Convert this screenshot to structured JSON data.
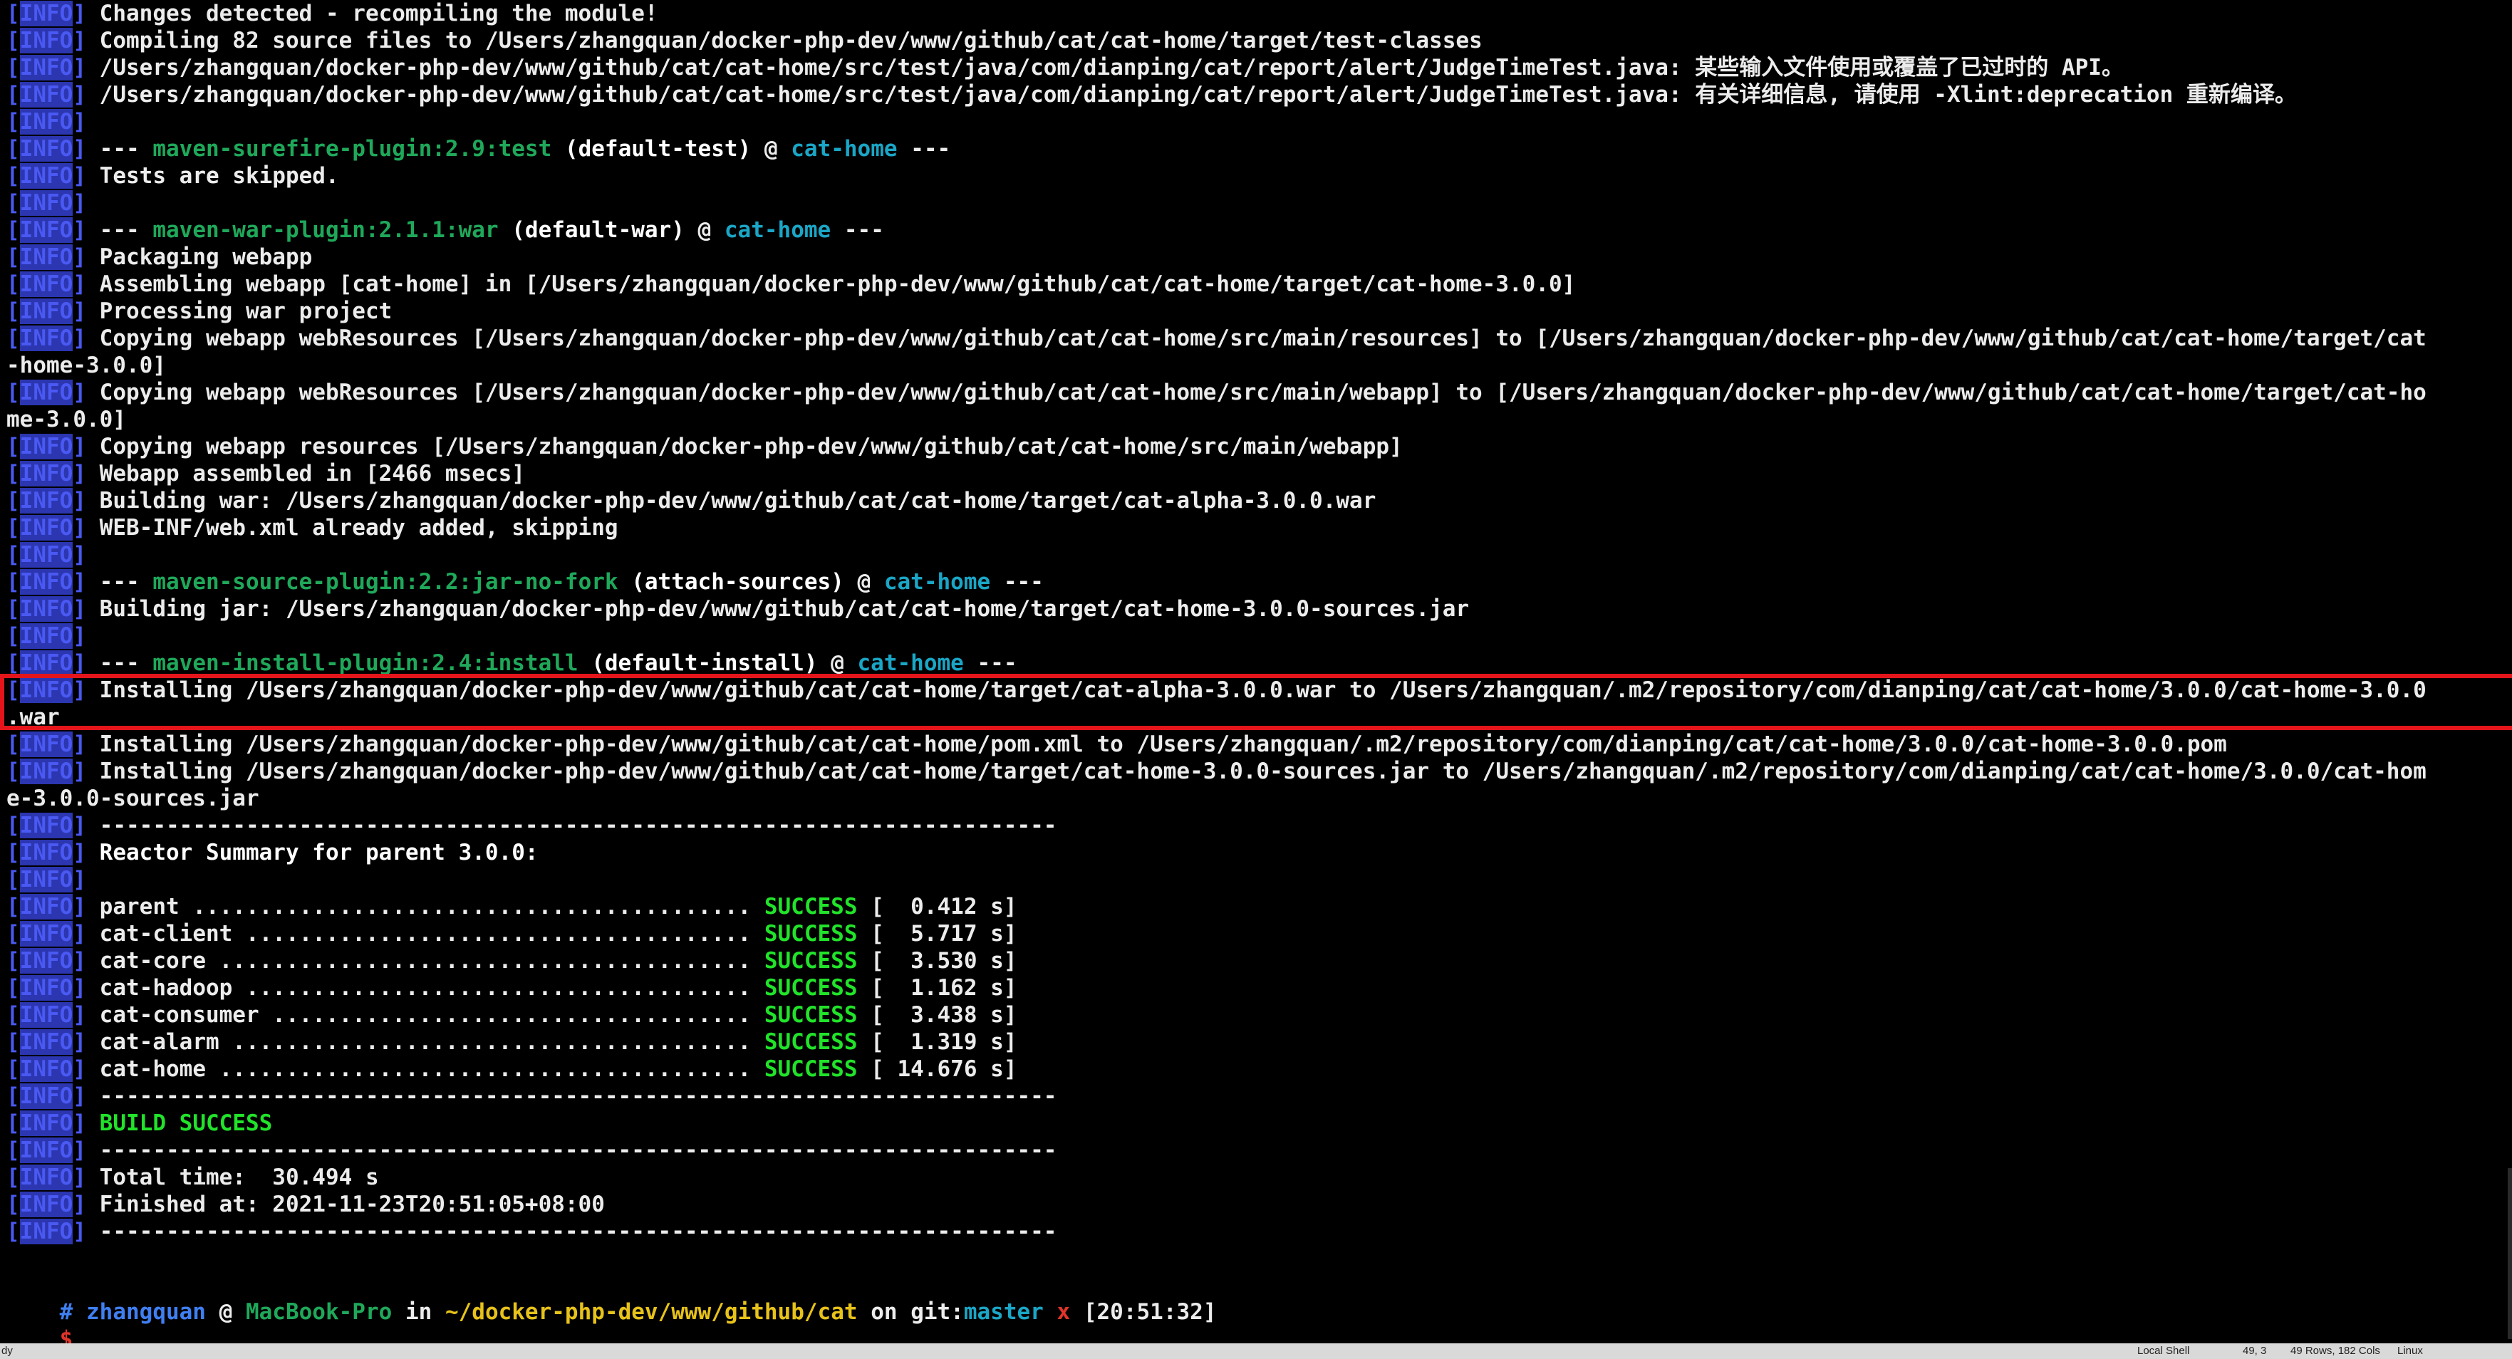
{
  "terminal": {
    "tag": "[INFO]",
    "lines": [
      [
        {
          "t": "Changes detected - recompiling the module!"
        }
      ],
      [
        {
          "t": "Compiling 82 source files to /Users/zhangquan/docker-php-dev/www/github/cat/cat-home/target/test-classes"
        }
      ],
      [
        {
          "t": "/Users/zhangquan/docker-php-dev/www/github/cat/cat-home/src/test/java/com/dianping/cat/report/alert/JudgeTimeTest.java: 某些输入文件使用或覆盖了已过时的 API。"
        }
      ],
      [
        {
          "t": "/Users/zhangquan/docker-php-dev/www/github/cat/cat-home/src/test/java/com/dianping/cat/report/alert/JudgeTimeTest.java: 有关详细信息, 请使用 -Xlint:deprecation 重新编译。"
        }
      ],
      [],
      [
        {
          "t": "--- "
        },
        {
          "t": "maven-surefire-plugin:2.9:test",
          "c": "green"
        },
        {
          "t": " (default-test)",
          "c": "bright"
        },
        {
          "t": " @ "
        },
        {
          "t": "cat-home",
          "c": "cyan"
        },
        {
          "t": " ---"
        }
      ],
      [
        {
          "t": "Tests are skipped."
        }
      ],
      [],
      [
        {
          "t": "--- "
        },
        {
          "t": "maven-war-plugin:2.1.1:war",
          "c": "green"
        },
        {
          "t": " (default-war)",
          "c": "bright"
        },
        {
          "t": " @ "
        },
        {
          "t": "cat-home",
          "c": "cyan"
        },
        {
          "t": " ---"
        }
      ],
      [
        {
          "t": "Packaging webapp"
        }
      ],
      [
        {
          "t": "Assembling webapp [cat-home] in [/Users/zhangquan/docker-php-dev/www/github/cat/cat-home/target/cat-home-3.0.0]"
        }
      ],
      [
        {
          "t": "Processing war project"
        }
      ],
      [
        {
          "t": "Copying webapp webResources [/Users/zhangquan/docker-php-dev/www/github/cat/cat-home/src/main/resources] to [/Users/zhangquan/docker-php-dev/www/github/cat/cat-home/target/cat"
        }
      ],
      {
        "cont": "-home-3.0.0]"
      },
      [
        {
          "t": "Copying webapp webResources [/Users/zhangquan/docker-php-dev/www/github/cat/cat-home/src/main/webapp] to [/Users/zhangquan/docker-php-dev/www/github/cat/cat-home/target/cat-ho"
        }
      ],
      {
        "cont": "me-3.0.0]"
      },
      [
        {
          "t": "Copying webapp resources [/Users/zhangquan/docker-php-dev/www/github/cat/cat-home/src/main/webapp]"
        }
      ],
      [
        {
          "t": "Webapp assembled in [2466 msecs]"
        }
      ],
      [
        {
          "t": "Building war: /Users/zhangquan/docker-php-dev/www/github/cat/cat-home/target/cat-alpha-3.0.0.war"
        }
      ],
      [
        {
          "t": "WEB-INF/web.xml already added, skipping"
        }
      ],
      [],
      [
        {
          "t": "--- "
        },
        {
          "t": "maven-source-plugin:2.2:jar-no-fork",
          "c": "green"
        },
        {
          "t": " (attach-sources)",
          "c": "bright"
        },
        {
          "t": " @ "
        },
        {
          "t": "cat-home",
          "c": "cyan"
        },
        {
          "t": " ---"
        }
      ],
      [
        {
          "t": "Building jar: /Users/zhangquan/docker-php-dev/www/github/cat/cat-home/target/cat-home-3.0.0-sources.jar"
        }
      ],
      [],
      [
        {
          "t": "--- "
        },
        {
          "t": "maven-install-plugin:2.4:install",
          "c": "green"
        },
        {
          "t": " (default-install)",
          "c": "bright"
        },
        {
          "t": " @ "
        },
        {
          "t": "cat-home",
          "c": "cyan"
        },
        {
          "t": " ---"
        }
      ],
      [
        {
          "t": "Installing /Users/zhangquan/docker-php-dev/www/github/cat/cat-home/target/cat-alpha-3.0.0.war to /Users/zhangquan/.m2/repository/com/dianping/cat/cat-home/3.0.0/cat-home-3.0.0"
        }
      ],
      {
        "cont": ".war"
      },
      [
        {
          "t": "Installing /Users/zhangquan/docker-php-dev/www/github/cat/cat-home/pom.xml to /Users/zhangquan/.m2/repository/com/dianping/cat/cat-home/3.0.0/cat-home-3.0.0.pom"
        }
      ],
      [
        {
          "t": "Installing /Users/zhangquan/docker-php-dev/www/github/cat/cat-home/target/cat-home-3.0.0-sources.jar to /Users/zhangquan/.m2/repository/com/dianping/cat/cat-home/3.0.0/cat-hom"
        }
      ],
      {
        "cont": "e-3.0.0-sources.jar"
      },
      [
        {
          "t": "------------------------------------------------------------------------"
        }
      ],
      [
        {
          "t": "Reactor Summary for parent 3.0.0:",
          "c": "bright"
        }
      ],
      [],
      [
        {
          "t": "parent .......................................... "
        },
        {
          "t": "SUCCESS",
          "c": "ok"
        },
        {
          "t": " [  0.412 s]"
        }
      ],
      [
        {
          "t": "cat-client ...................................... "
        },
        {
          "t": "SUCCESS",
          "c": "ok"
        },
        {
          "t": " [  5.717 s]"
        }
      ],
      [
        {
          "t": "cat-core ........................................ "
        },
        {
          "t": "SUCCESS",
          "c": "ok"
        },
        {
          "t": " [  3.530 s]"
        }
      ],
      [
        {
          "t": "cat-hadoop ...................................... "
        },
        {
          "t": "SUCCESS",
          "c": "ok"
        },
        {
          "t": " [  1.162 s]"
        }
      ],
      [
        {
          "t": "cat-consumer .................................... "
        },
        {
          "t": "SUCCESS",
          "c": "ok"
        },
        {
          "t": " [  3.438 s]"
        }
      ],
      [
        {
          "t": "cat-alarm ....................................... "
        },
        {
          "t": "SUCCESS",
          "c": "ok"
        },
        {
          "t": " [  1.319 s]"
        }
      ],
      [
        {
          "t": "cat-home ........................................ "
        },
        {
          "t": "SUCCESS",
          "c": "ok"
        },
        {
          "t": " [ 14.676 s]"
        }
      ],
      [
        {
          "t": "------------------------------------------------------------------------"
        }
      ],
      [
        {
          "t": "BUILD SUCCESS",
          "c": "success"
        }
      ],
      [
        {
          "t": "------------------------------------------------------------------------"
        }
      ],
      [
        {
          "t": "Total time:  30.494 s"
        }
      ],
      [
        {
          "t": "Finished at: 2021-11-23T20:51:05+08:00"
        }
      ],
      [
        {
          "t": "------------------------------------------------------------------------"
        }
      ]
    ],
    "prompt": {
      "marker": "#",
      "user": "zhangquan",
      "at": " @ ",
      "host": "MacBook-Pro",
      "in": " in ",
      "path": "~/docker-php-dev/www/github/cat",
      "on": " on ",
      "git_label": "git:",
      "branch": "master",
      "dirty": "x",
      "time": "[20:51:32]",
      "dollar": "$"
    }
  },
  "statusbar": {
    "left": "dy",
    "shell": "Local Shell",
    "cursor": "49, 3",
    "size": "49 Rows, 182 Cols",
    "os": "Linux"
  }
}
